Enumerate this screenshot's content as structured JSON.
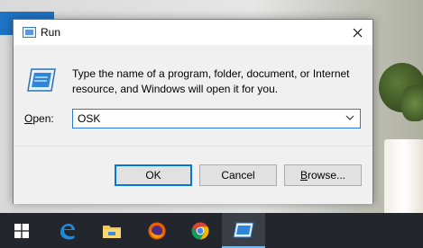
{
  "dialog": {
    "title": "Run",
    "description": "Type the name of a program, folder, document, or Internet resource, and Windows will open it for you.",
    "open_label_prefix": "O",
    "open_label_rest": "pen:",
    "open_value": "OSK",
    "buttons": {
      "ok": "OK",
      "cancel": "Cancel",
      "browse_prefix": "B",
      "browse_rest": "rowse..."
    }
  },
  "taskbar": {
    "items": [
      "start-button",
      "edge",
      "file-explorer",
      "firefox",
      "chrome",
      "run-app"
    ]
  },
  "colors": {
    "accent": "#0078d7",
    "taskbar": "#23272d"
  }
}
